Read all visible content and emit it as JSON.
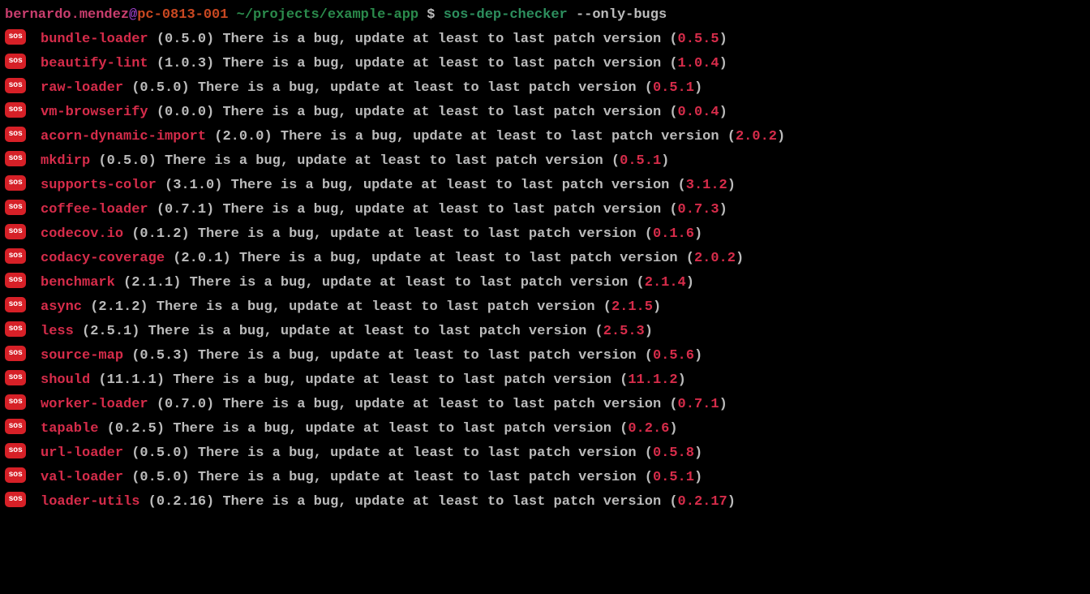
{
  "prompt": {
    "user": "bernardo.mendez",
    "at": "@",
    "host": "pc-0813-001",
    "path": "~/projects/example-app",
    "dollar": "$",
    "cmd": "sos-dep-checker",
    "args": "--only-bugs"
  },
  "badge": "sos",
  "msg_prefix": "There is a bug, update at least to last patch version",
  "items": [
    {
      "pkg": "bundle-loader",
      "cur": "0.5.0",
      "new": "0.5.5"
    },
    {
      "pkg": "beautify-lint",
      "cur": "1.0.3",
      "new": "1.0.4"
    },
    {
      "pkg": "raw-loader",
      "cur": "0.5.0",
      "new": "0.5.1"
    },
    {
      "pkg": "vm-browserify",
      "cur": "0.0.0",
      "new": "0.0.4"
    },
    {
      "pkg": "acorn-dynamic-import",
      "cur": "2.0.0",
      "new": "2.0.2"
    },
    {
      "pkg": "mkdirp",
      "cur": "0.5.0",
      "new": "0.5.1"
    },
    {
      "pkg": "supports-color",
      "cur": "3.1.0",
      "new": "3.1.2"
    },
    {
      "pkg": "coffee-loader",
      "cur": "0.7.1",
      "new": "0.7.3"
    },
    {
      "pkg": "codecov.io",
      "cur": "0.1.2",
      "new": "0.1.6"
    },
    {
      "pkg": "codacy-coverage",
      "cur": "2.0.1",
      "new": "2.0.2"
    },
    {
      "pkg": "benchmark",
      "cur": "2.1.1",
      "new": "2.1.4"
    },
    {
      "pkg": "async",
      "cur": "2.1.2",
      "new": "2.1.5"
    },
    {
      "pkg": "less",
      "cur": "2.5.1",
      "new": "2.5.3"
    },
    {
      "pkg": "source-map",
      "cur": "0.5.3",
      "new": "0.5.6"
    },
    {
      "pkg": "should",
      "cur": "11.1.1",
      "new": "11.1.2"
    },
    {
      "pkg": "worker-loader",
      "cur": "0.7.0",
      "new": "0.7.1"
    },
    {
      "pkg": "tapable",
      "cur": "0.2.5",
      "new": "0.2.6"
    },
    {
      "pkg": "url-loader",
      "cur": "0.5.0",
      "new": "0.5.8"
    },
    {
      "pkg": "val-loader",
      "cur": "0.5.0",
      "new": "0.5.1"
    },
    {
      "pkg": "loader-utils",
      "cur": "0.2.16",
      "new": "0.2.17"
    }
  ]
}
